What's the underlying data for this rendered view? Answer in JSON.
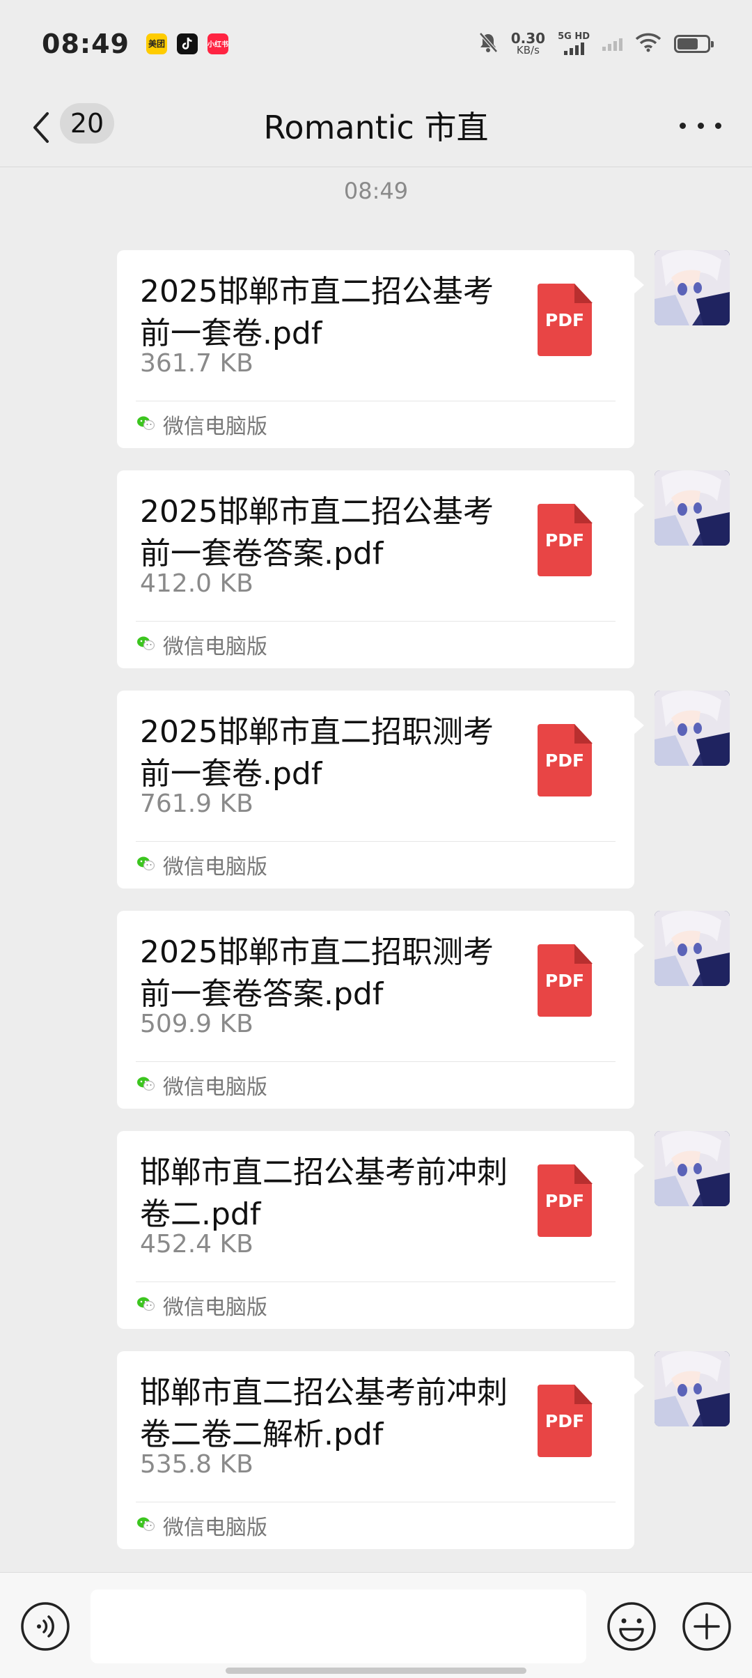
{
  "status_bar": {
    "time": "08:49",
    "apps": [
      "美团",
      "抖音",
      "小红书"
    ],
    "network_speed_value": "0.30",
    "network_speed_unit": "KB/s",
    "signal_label": "5G HD",
    "battery_level": 0.7,
    "icons": [
      "bell-muted-icon",
      "signal-icon",
      "wifi-icon",
      "battery-icon"
    ]
  },
  "nav": {
    "back_icon": "chevron-left-icon",
    "unread_count": "20",
    "title": "Romantic 市直",
    "more_icon": "more-horizontal-icon"
  },
  "chat": {
    "timestamp": "08:49",
    "messages": [
      {
        "file_name": "2025邯郸市直二招公基考前一套卷.pdf",
        "file_size": "361.7 KB",
        "file_type": "PDF",
        "source": "微信电脑版"
      },
      {
        "file_name": "2025邯郸市直二招公基考前一套卷答案.pdf",
        "file_size": "412.0 KB",
        "file_type": "PDF",
        "source": "微信电脑版"
      },
      {
        "file_name": "2025邯郸市直二招职测考前一套卷.pdf",
        "file_size": "761.9 KB",
        "file_type": "PDF",
        "source": "微信电脑版"
      },
      {
        "file_name": "2025邯郸市直二招职测考前一套卷答案.pdf",
        "file_size": "509.9 KB",
        "file_type": "PDF",
        "source": "微信电脑版"
      },
      {
        "file_name": "邯郸市直二招公基考前冲刺卷二.pdf",
        "file_size": "452.4 KB",
        "file_type": "PDF",
        "source": "微信电脑版"
      },
      {
        "file_name": "邯郸市直二招公基考前冲刺卷二卷二解析.pdf",
        "file_size": "535.8 KB",
        "file_type": "PDF",
        "source": "微信电脑版"
      }
    ]
  },
  "input_bar": {
    "voice_icon": "voice-icon",
    "emoji_icon": "emoji-icon",
    "plus_icon": "plus-icon"
  },
  "colors": {
    "background": "#ededed",
    "bubble": "#ffffff",
    "pdf_red": "#e84545",
    "wechat_green": "#3cc51f"
  }
}
